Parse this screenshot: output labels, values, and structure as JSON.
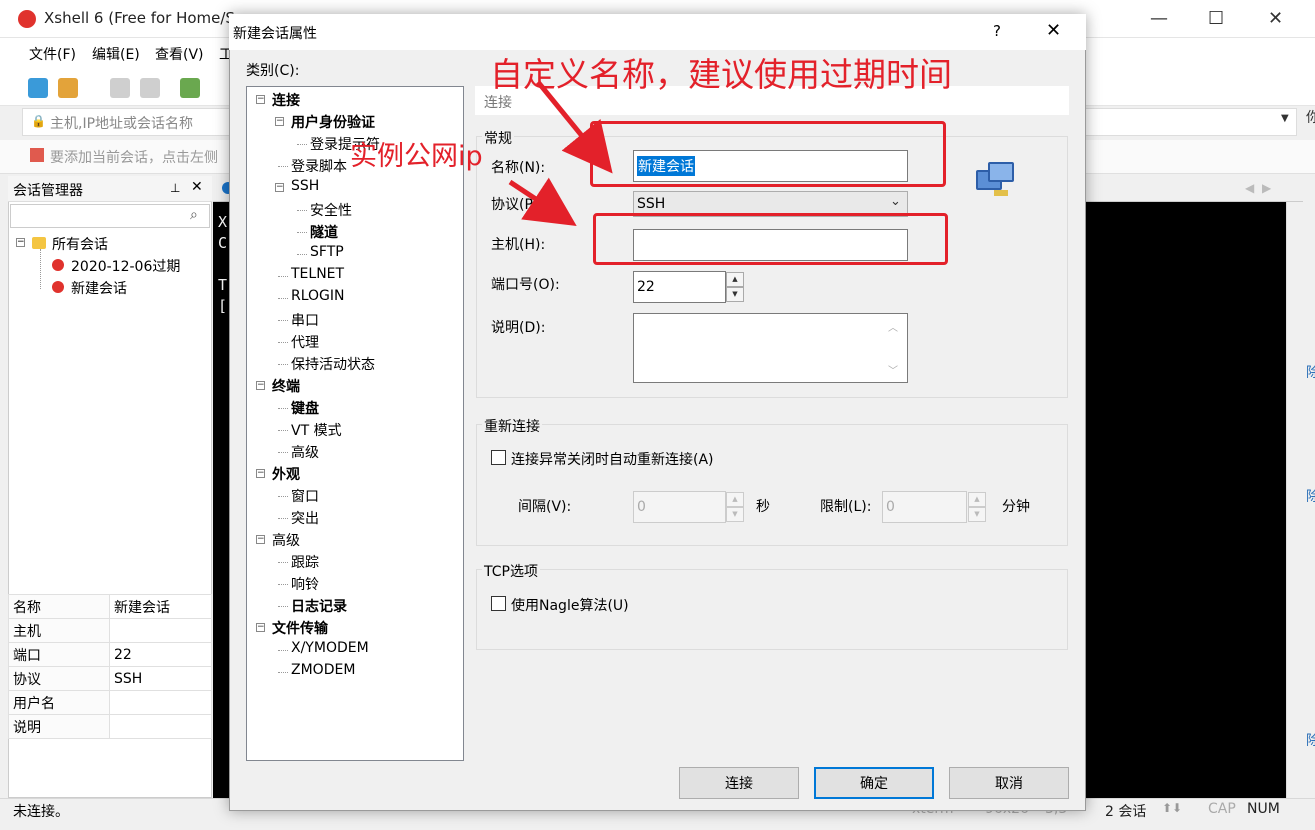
{
  "app": {
    "title": "Xshell 6 (Free for Home/S",
    "title_suffix": "...",
    "menu": [
      "文件(F)",
      "编辑(E)",
      "查看(V)",
      "工"
    ],
    "address_placeholder": "主机,IP地址或会话名称",
    "hint": "要添加当前会话，点击左侧",
    "window_controls": [
      "—",
      "☐",
      "✕"
    ]
  },
  "session_manager": {
    "title": "会话管理器",
    "pin": "⊥",
    "close": "✕",
    "tree": {
      "root": "所有会话",
      "items": [
        "2020-12-06过期",
        "新建会话"
      ]
    },
    "properties": [
      {
        "key": "名称",
        "value": "新建会话"
      },
      {
        "key": "主机",
        "value": ""
      },
      {
        "key": "端口",
        "value": "22"
      },
      {
        "key": "协议",
        "value": "SSH"
      },
      {
        "key": "用户名",
        "value": ""
      },
      {
        "key": "说明",
        "value": ""
      }
    ]
  },
  "terminal": {
    "lines": "X\nC\n\nT\n["
  },
  "status": {
    "text": "未连接。",
    "xterm": "xterm",
    "size": "96x26",
    "pos": "3,3",
    "sessions": "2 会话",
    "cap": "CAP",
    "num": "NUM",
    "edge_chars": [
      "你",
      "除",
      "除",
      "除"
    ]
  },
  "dialog": {
    "title": "新建会话属性",
    "help": "?",
    "close": "✕",
    "category_label": "类别(C):",
    "category_tree": [
      {
        "label": "连接",
        "level": 0,
        "bold": true,
        "expander": "−"
      },
      {
        "label": "用户身份验证",
        "level": 1,
        "bold": true,
        "expander": "−"
      },
      {
        "label": "登录提示符",
        "level": 2,
        "bold": false
      },
      {
        "label": "登录脚本",
        "level": 1,
        "bold": false
      },
      {
        "label": "SSH",
        "level": 1,
        "bold": false,
        "expander": "−"
      },
      {
        "label": "安全性",
        "level": 2,
        "bold": false
      },
      {
        "label": "隧道",
        "level": 2,
        "bold": true
      },
      {
        "label": "SFTP",
        "level": 2,
        "bold": false
      },
      {
        "label": "TELNET",
        "level": 1,
        "bold": false
      },
      {
        "label": "RLOGIN",
        "level": 1,
        "bold": false
      },
      {
        "label": "串口",
        "level": 1,
        "bold": false
      },
      {
        "label": "代理",
        "level": 1,
        "bold": false
      },
      {
        "label": "保持活动状态",
        "level": 1,
        "bold": false
      },
      {
        "label": "终端",
        "level": 0,
        "bold": true,
        "expander": "−"
      },
      {
        "label": "键盘",
        "level": 1,
        "bold": true
      },
      {
        "label": "VT 模式",
        "level": 1,
        "bold": false
      },
      {
        "label": "高级",
        "level": 1,
        "bold": false
      },
      {
        "label": "外观",
        "level": 0,
        "bold": true,
        "expander": "−"
      },
      {
        "label": "窗口",
        "level": 1,
        "bold": false
      },
      {
        "label": "突出",
        "level": 1,
        "bold": false
      },
      {
        "label": "高级",
        "level": 0,
        "bold": false,
        "expander": "−"
      },
      {
        "label": "跟踪",
        "level": 1,
        "bold": false
      },
      {
        "label": "响铃",
        "level": 1,
        "bold": false
      },
      {
        "label": "日志记录",
        "level": 1,
        "bold": true
      },
      {
        "label": "文件传输",
        "level": 0,
        "bold": true,
        "expander": "−"
      },
      {
        "label": "X/YMODEM",
        "level": 1,
        "bold": false
      },
      {
        "label": "ZMODEM",
        "level": 1,
        "bold": false
      }
    ],
    "section_header": "连接",
    "general": {
      "title": "常规",
      "name_label": "名称(N):",
      "name_value": "新建会话",
      "protocol_label": "协议(P):",
      "protocol_value": "SSH",
      "host_label": "主机(H):",
      "host_value": "",
      "port_label": "端口号(O):",
      "port_value": "22",
      "desc_label": "说明(D):",
      "desc_value": ""
    },
    "reconnect": {
      "title": "重新连接",
      "checkbox_label": "连接异常关闭时自动重新连接(A)",
      "interval_label": "间隔(V):",
      "interval_value": "0",
      "interval_unit": "秒",
      "limit_label": "限制(L):",
      "limit_value": "0",
      "limit_unit": "分钟"
    },
    "tcp": {
      "title": "TCP选项",
      "nagle_label": "使用Nagle算法(U)"
    },
    "buttons": {
      "connect": "连接",
      "ok": "确定",
      "cancel": "取消"
    }
  },
  "annotations": {
    "name_note": "自定义名称，建议使用过期时间",
    "host_note": "实例公网ip",
    "color": "#e3212a"
  }
}
